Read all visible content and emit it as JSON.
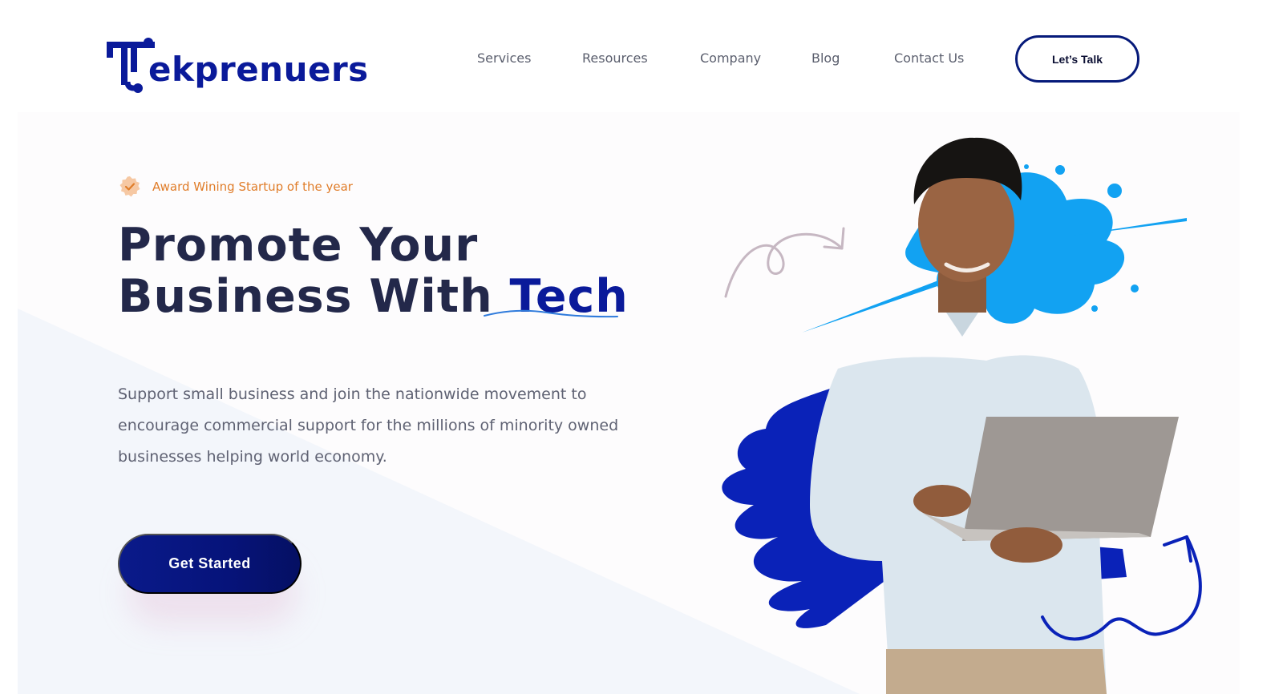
{
  "brand": {
    "logo_text": "ekprenuers",
    "logo_initial": "T",
    "primary_color": "#0a1a9a",
    "accent_color": "#e07d2a"
  },
  "nav": {
    "items": [
      {
        "label": "Services"
      },
      {
        "label": "Resources"
      },
      {
        "label": "Company"
      },
      {
        "label": "Blog"
      },
      {
        "label": "Contact Us"
      }
    ],
    "cta_label": "Let’s Talk"
  },
  "hero": {
    "badge": {
      "icon": "verified-badge-icon",
      "text": "Award Wining Startup of the year"
    },
    "headline_line1": "Promote Your",
    "headline_line2_prefix": "Business With ",
    "headline_accent": "Tech",
    "lead": "Support small business and join the nationwide movement to encourage commercial support for the millions of minority owned businesses helping world economy.",
    "cta_label": "Get Started"
  },
  "illustration": {
    "subject": "person-with-laptop",
    "splash_colors": [
      "#0a2fbf",
      "#0aa3f5"
    ]
  }
}
